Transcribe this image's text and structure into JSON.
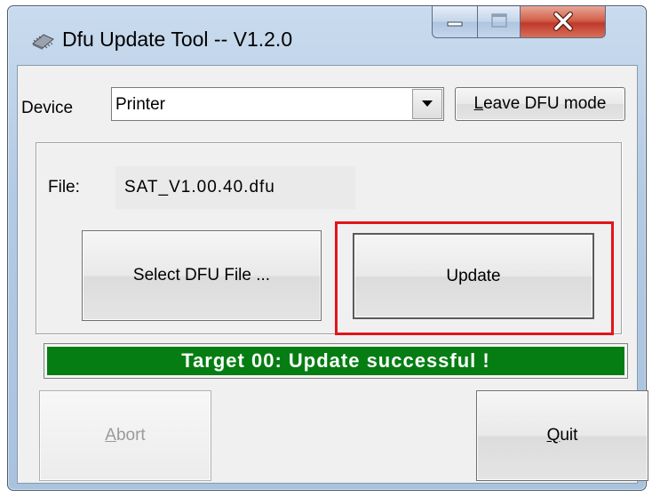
{
  "window": {
    "title": "Dfu Update Tool -- V1.2.0",
    "app_icon": "chip-icon"
  },
  "caption_buttons": {
    "minimize_icon": "minimize-icon",
    "maximize_icon": "maximize-icon",
    "close_icon": "close-icon"
  },
  "device": {
    "label": "Device",
    "selected": "Printer",
    "dropdown_icon": "chevron-down-icon"
  },
  "buttons": {
    "leave_dfu_first": "L",
    "leave_dfu_rest": "eave DFU mode",
    "select_file": "Select DFU File ...",
    "update": "Update",
    "abort_first": "A",
    "abort_rest": "bort",
    "quit_first": "Q",
    "quit_rest": "uit"
  },
  "file": {
    "label": "File:",
    "value": "SAT_V1.00.40.dfu"
  },
  "status": {
    "message": "Target 00: Update successful !",
    "progress": 1.0
  },
  "colors": {
    "status_green": "#057d12",
    "highlight_red": "#e3141b",
    "close_red": "#c0392b"
  }
}
